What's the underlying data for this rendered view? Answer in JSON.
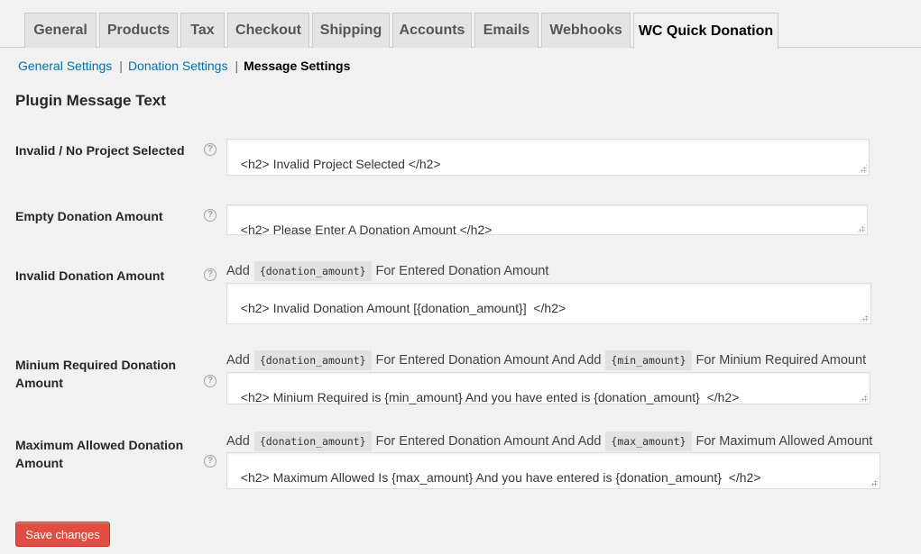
{
  "tabs": [
    {
      "label": "General"
    },
    {
      "label": "Products"
    },
    {
      "label": "Tax"
    },
    {
      "label": "Checkout"
    },
    {
      "label": "Shipping"
    },
    {
      "label": "Accounts"
    },
    {
      "label": "Emails"
    },
    {
      "label": "Webhooks"
    },
    {
      "label": "WC Quick Donation",
      "active": true
    }
  ],
  "subnav": {
    "general": "General Settings",
    "donation": "Donation Settings",
    "message": "Message Settings",
    "separator": "|"
  },
  "section_title": "Plugin Message Text",
  "help_glyph": "?",
  "rows": [
    {
      "label": "Invalid / No Project Selected",
      "value": "<h2> Invalid Project Selected </h2>"
    },
    {
      "label": "Empty Donation Amount",
      "value": "<h2> Please Enter A Donation Amount </h2>"
    },
    {
      "label": "Invalid Donation Amount",
      "desc": {
        "prefix": "Add",
        "code1": "{donation_amount}",
        "text1": "For Entered Donation Amount"
      },
      "value": "<h2> Invalid Donation Amount [{donation_amount}]  </h2>"
    },
    {
      "label": "Minium Required Donation Amount",
      "desc": {
        "prefix": "Add",
        "code1": "{donation_amount}",
        "text1": "For Entered Donation Amount And Add",
        "code2": "{min_amount}",
        "text2": "For Minium Required Amount"
      },
      "value": "<h2> Minium Required is {min_amount} And you have ented is {donation_amount}  </h2>"
    },
    {
      "label": "Maximum Allowed Donation Amount",
      "desc": {
        "prefix": "Add",
        "code1": "{donation_amount}",
        "text1": "For Entered Donation Amount And Add",
        "code2": "{max_amount}",
        "text2": "For Maximum Allowed Amount"
      },
      "value": "<h2> Maximum Allowed Is {max_amount} And you have entered is {donation_amount}  </h2>"
    }
  ],
  "save_label": "Save changes",
  "colors": {
    "link": "#0073aa",
    "button": "#e14d43",
    "background": "#f1f1f1",
    "tab_inactive": "#e4e4e4"
  }
}
